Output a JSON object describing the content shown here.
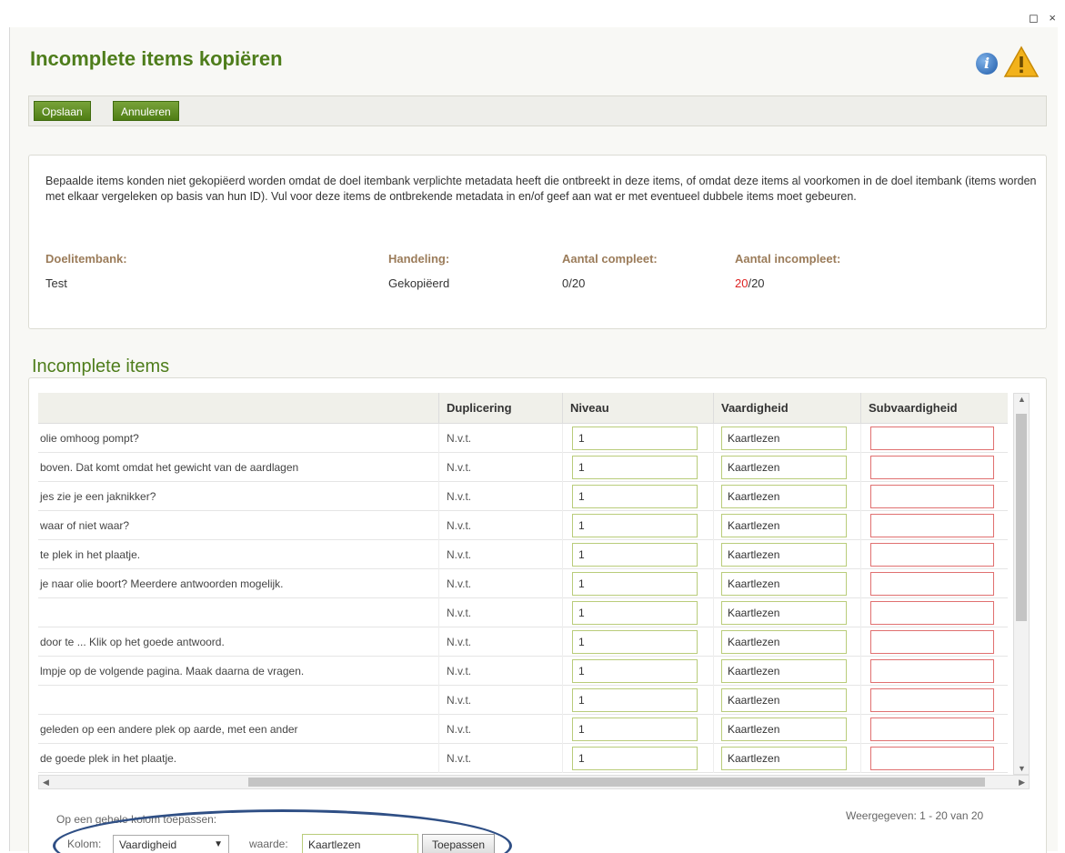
{
  "window": {
    "controls": "◻ ×"
  },
  "dialog": {
    "title": "Incomplete items kopiëren",
    "toolbar": {
      "save_label": "Opslaan",
      "cancel_label": "Annuleren"
    },
    "description": "Bepaalde items konden niet gekopiëerd worden omdat de doel itembank verplichte metadata heeft die ontbreekt in deze items, of omdat deze items al voorkomen in de doel itembank (items worden met elkaar vergeleken op basis van hun ID). Vul voor deze items de ontbrekende metadata in en/of geef aan wat er met eventueel dubbele items moet gebeuren.",
    "meta": {
      "target_label": "Doelitembank:",
      "target_value": "Test",
      "action_label": "Handeling:",
      "action_value": "Gekopiëerd",
      "complete_label": "Aantal compleet:",
      "complete_value": "0/20",
      "incomplete_label": "Aantal incompleet:",
      "incomplete_count": "20",
      "incomplete_total": "/20"
    }
  },
  "grid": {
    "section_title": "Incomplete items",
    "headers": {
      "question": "",
      "duplication": "Duplicering",
      "level": "Niveau",
      "skill": "Vaardigheid",
      "subskill": "Subvaardigheid"
    },
    "rows": [
      {
        "q": "olie omhoog pompt?",
        "d": "N.v.t.",
        "n": "1",
        "v": "Kaartlezen",
        "s": ""
      },
      {
        "q": "boven. Dat komt omdat het gewicht van de aardlagen",
        "d": "N.v.t.",
        "n": "1",
        "v": "Kaartlezen",
        "s": ""
      },
      {
        "q": "jes zie je een jaknikker?",
        "d": "N.v.t.",
        "n": "1",
        "v": "Kaartlezen",
        "s": ""
      },
      {
        "q": "waar of niet waar?",
        "d": "N.v.t.",
        "n": "1",
        "v": "Kaartlezen",
        "s": ""
      },
      {
        "q": "te plek in het plaatje.",
        "d": "N.v.t.",
        "n": "1",
        "v": "Kaartlezen",
        "s": ""
      },
      {
        "q": "je naar olie boort? Meerdere antwoorden mogelijk.",
        "d": "N.v.t.",
        "n": "1",
        "v": "Kaartlezen",
        "s": ""
      },
      {
        "q": "",
        "d": "N.v.t.",
        "n": "1",
        "v": "Kaartlezen",
        "s": ""
      },
      {
        "q": "door te ... Klik op het goede antwoord.",
        "d": "N.v.t.",
        "n": "1",
        "v": "Kaartlezen",
        "s": ""
      },
      {
        "q": "lmpje op de volgende pagina. Maak daarna de vragen.",
        "d": "N.v.t.",
        "n": "1",
        "v": "Kaartlezen",
        "s": ""
      },
      {
        "q": "",
        "d": "N.v.t.",
        "n": "1",
        "v": "Kaartlezen",
        "s": ""
      },
      {
        "q": "geleden op een andere plek op aarde, met een ander",
        "d": "N.v.t.",
        "n": "1",
        "v": "Kaartlezen",
        "s": ""
      },
      {
        "q": "de goede plek in het plaatje.",
        "d": "N.v.t.",
        "n": "1",
        "v": "Kaartlezen",
        "s": ""
      }
    ]
  },
  "footer": {
    "apply_column_label": "Op een gehele kolom toepassen:",
    "column_label": "Kolom:",
    "column_value": "Vaardigheid",
    "value_label": "waarde:",
    "value_input": "Kaartlezen",
    "apply_button": "Toepassen",
    "paging": "Weergegeven: 1 - 20 van 20"
  },
  "colors": {
    "accent": "#4e7d1b",
    "label_brown": "#9b7c5a",
    "highlight_red": "#dd2222",
    "ellipse": "#2f4f85"
  }
}
